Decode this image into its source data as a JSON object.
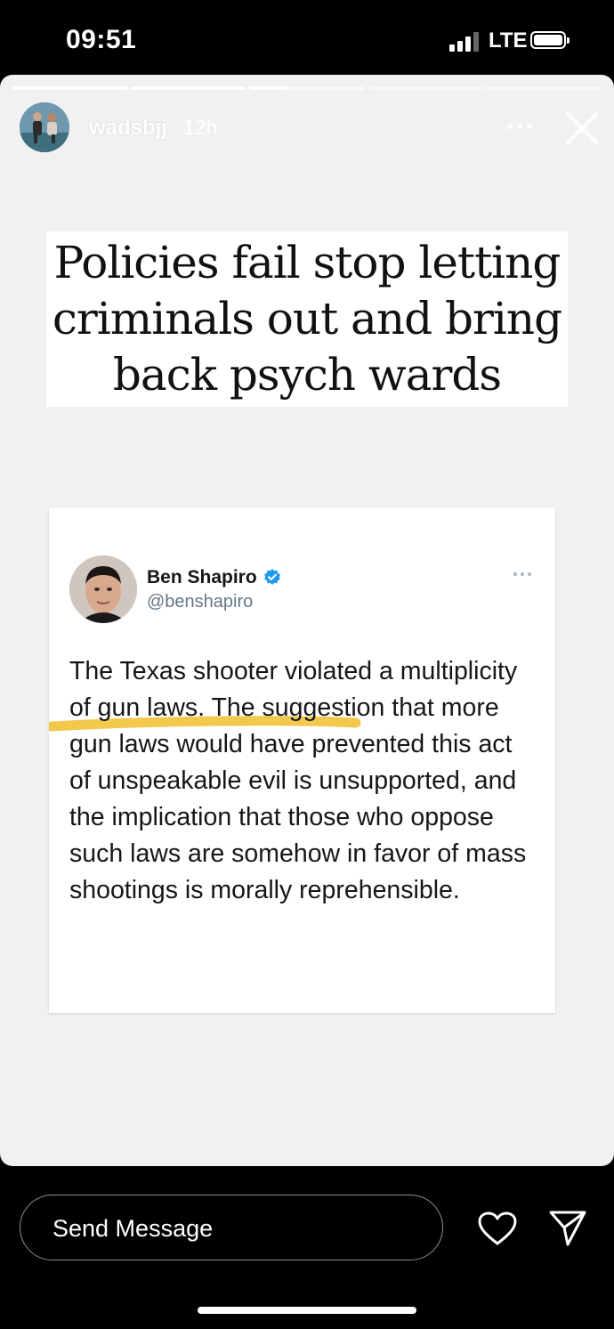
{
  "status_bar": {
    "time": "09:51",
    "network": "LTE",
    "signal_bars_active": 3,
    "signal_bars_total": 4,
    "battery_icon": "battery-full-icon"
  },
  "story": {
    "progress_segments": [
      1,
      1,
      0.3,
      0,
      0
    ],
    "username": "wadsbjj",
    "posted_ago": "12h",
    "headline": "Policies fail stop letting criminals out and bring back psych wards",
    "tweet": {
      "name": "Ben Shapiro",
      "handle": "@benshapiro",
      "verified": true,
      "text": "The Texas shooter violated a multiplicity of gun laws. The suggestion that more gun laws would have prevented this act of unspeakable evil is unsupported, and the implication that those who oppose such laws are somehow in favor of mass shootings is morally reprehensible.",
      "highlight_color": "#f2c94c"
    }
  },
  "reply_bar": {
    "placeholder": "Send Message"
  },
  "colors": {
    "story_background": "#f1f1f1",
    "verified_blue": "#1d9bf0",
    "app_background": "#000000"
  }
}
